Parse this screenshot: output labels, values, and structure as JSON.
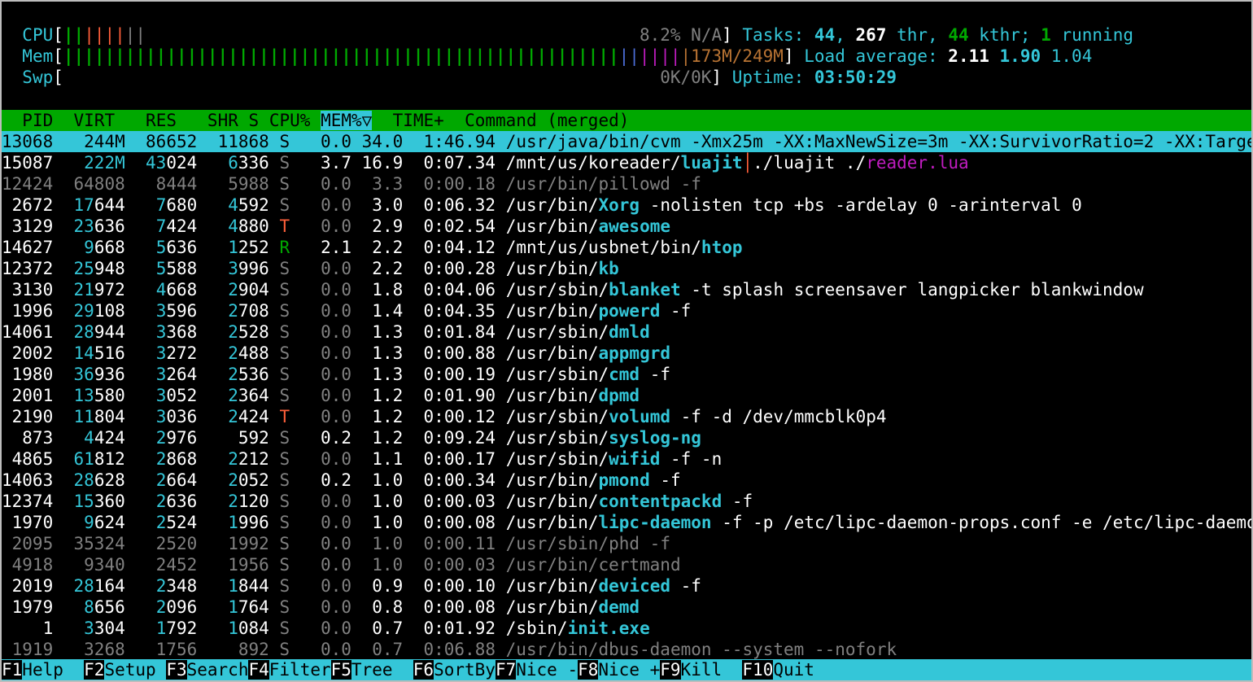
{
  "meters": {
    "cpu": {
      "label": "CPU",
      "bar_user": "||||",
      "bar_sys": "|||",
      "value": "8.2% N/A"
    },
    "mem": {
      "label": "Mem",
      "bar_used": "||||||||||||||||||||||||||||||||||||||||||||||||||||||||||||",
      "bar_buffer": "||||",
      "bar_cache": "||||",
      "value": "173M/249M"
    },
    "swp": {
      "label": "Swp",
      "bar": "",
      "value": "0K/0K"
    }
  },
  "tasks": {
    "label": "Tasks:",
    "count": "44",
    "threads": "267",
    "thr_label": "thr,",
    "kthreads": "44",
    "kthr_label": "kthr;",
    "running": "1",
    "running_label": "running"
  },
  "load": {
    "label": "Load average:",
    "one": "2.11",
    "five": "1.90",
    "fifteen": "1.04"
  },
  "uptime": {
    "label": "Uptime:",
    "value": "03:50:29"
  },
  "columns": {
    "pid": "PID",
    "virt": "VIRT",
    "res": "RES",
    "shr": "SHR",
    "s": "S",
    "cpu": "CPU%",
    "mem": "MEM%▽",
    "time": "TIME+",
    "command": "Command (merged)"
  },
  "processes": [
    {
      "pid": "13068",
      "virt": "244M",
      "res": "86652",
      "shr": "11868",
      "s": "S",
      "cpu": "0.0",
      "mem": "34.0",
      "time": "1:46.94",
      "path": "/usr/java/bin/cvm",
      "exe": "",
      "args": " -Xmx25m -XX:MaxNewSize=3m -XX:SurvivorRatio=2 -XX:Targe",
      "selected": true
    },
    {
      "pid": "15087",
      "virt": "222M",
      "res": "43024",
      "shr": "6336",
      "s": "S",
      "cpu": "3.7",
      "mem": "16.9",
      "time": "0:07.34",
      "path": "/mnt/us/koreader/",
      "exe": "luajit",
      "args": "./luajit ./",
      "extra": "reader.lua",
      "sep": "│"
    },
    {
      "pid": "12424",
      "virt": "64808",
      "res": "8444",
      "shr": "5988",
      "s": "S",
      "cpu": "0.0",
      "mem": "3.3",
      "time": "0:00.18",
      "path": "/usr/bin/pillowd",
      "exe": "",
      "args": " -f",
      "dim": true
    },
    {
      "pid": "2672",
      "virt": "17644",
      "res": "7680",
      "shr": "4592",
      "s": "S",
      "cpu": "0.0",
      "mem": "3.0",
      "time": "0:06.32",
      "path": "/usr/bin/",
      "exe": "Xorg",
      "args": " -nolisten tcp +bs -ardelay 0 -arinterval 0"
    },
    {
      "pid": "3129",
      "virt": "23636",
      "res": "7424",
      "shr": "4880",
      "s": "T",
      "cpu": "0.0",
      "mem": "2.9",
      "time": "0:02.54",
      "path": "/usr/bin/",
      "exe": "awesome",
      "args": ""
    },
    {
      "pid": "14627",
      "virt": "9668",
      "res": "5636",
      "shr": "1252",
      "s": "R",
      "cpu": "2.1",
      "mem": "2.2",
      "time": "0:04.12",
      "path": "/mnt/us/usbnet/bin/",
      "exe": "htop",
      "args": ""
    },
    {
      "pid": "12372",
      "virt": "25948",
      "res": "5588",
      "shr": "3996",
      "s": "S",
      "cpu": "0.0",
      "mem": "2.2",
      "time": "0:00.28",
      "path": "/usr/bin/",
      "exe": "kb",
      "args": ""
    },
    {
      "pid": "3130",
      "virt": "21972",
      "res": "4668",
      "shr": "2904",
      "s": "S",
      "cpu": "0.0",
      "mem": "1.8",
      "time": "0:04.06",
      "path": "/usr/sbin/",
      "exe": "blanket",
      "args": " -t splash screensaver langpicker blankwindow"
    },
    {
      "pid": "1996",
      "virt": "29108",
      "res": "3596",
      "shr": "2708",
      "s": "S",
      "cpu": "0.0",
      "mem": "1.4",
      "time": "0:04.35",
      "path": "/usr/bin/",
      "exe": "powerd",
      "args": " -f"
    },
    {
      "pid": "14061",
      "virt": "28944",
      "res": "3368",
      "shr": "2528",
      "s": "S",
      "cpu": "0.0",
      "mem": "1.3",
      "time": "0:01.84",
      "path": "/usr/sbin/",
      "exe": "dmld",
      "args": ""
    },
    {
      "pid": "2002",
      "virt": "14516",
      "res": "3272",
      "shr": "2488",
      "s": "S",
      "cpu": "0.0",
      "mem": "1.3",
      "time": "0:00.88",
      "path": "/usr/bin/",
      "exe": "appmgrd",
      "args": ""
    },
    {
      "pid": "1980",
      "virt": "36936",
      "res": "3264",
      "shr": "2536",
      "s": "S",
      "cpu": "0.0",
      "mem": "1.3",
      "time": "0:00.19",
      "path": "/usr/sbin/",
      "exe": "cmd",
      "args": " -f"
    },
    {
      "pid": "2001",
      "virt": "13580",
      "res": "3052",
      "shr": "2364",
      "s": "S",
      "cpu": "0.0",
      "mem": "1.2",
      "time": "0:01.90",
      "path": "/usr/bin/",
      "exe": "dpmd",
      "args": ""
    },
    {
      "pid": "2190",
      "virt": "11804",
      "res": "3036",
      "shr": "2424",
      "s": "T",
      "cpu": "0.0",
      "mem": "1.2",
      "time": "0:00.12",
      "path": "/usr/sbin/",
      "exe": "volumd",
      "args": " -f -d /dev/mmcblk0p4"
    },
    {
      "pid": "873",
      "virt": "4424",
      "res": "2976",
      "shr": "592",
      "s": "S",
      "cpu": "0.2",
      "mem": "1.2",
      "time": "0:09.24",
      "path": "/usr/sbin/",
      "exe": "syslog-ng",
      "args": ""
    },
    {
      "pid": "4865",
      "virt": "61812",
      "res": "2868",
      "shr": "2212",
      "s": "S",
      "cpu": "0.0",
      "mem": "1.1",
      "time": "0:00.17",
      "path": "/usr/sbin/",
      "exe": "wifid",
      "args": " -f -n"
    },
    {
      "pid": "14063",
      "virt": "28628",
      "res": "2664",
      "shr": "2052",
      "s": "S",
      "cpu": "0.2",
      "mem": "1.0",
      "time": "0:00.34",
      "path": "/usr/bin/",
      "exe": "pmond",
      "args": " -f"
    },
    {
      "pid": "12374",
      "virt": "15360",
      "res": "2636",
      "shr": "2120",
      "s": "S",
      "cpu": "0.0",
      "mem": "1.0",
      "time": "0:00.03",
      "path": "/usr/bin/",
      "exe": "contentpackd",
      "args": " -f"
    },
    {
      "pid": "1970",
      "virt": "9624",
      "res": "2524",
      "shr": "1996",
      "s": "S",
      "cpu": "0.0",
      "mem": "1.0",
      "time": "0:00.08",
      "path": "/usr/bin/",
      "exe": "lipc-daemon",
      "args": " -f -p /etc/lipc-daemon-props.conf -e /etc/lipc-daemo"
    },
    {
      "pid": "2095",
      "virt": "35324",
      "res": "2520",
      "shr": "1992",
      "s": "S",
      "cpu": "0.0",
      "mem": "1.0",
      "time": "0:00.11",
      "path": "/usr/sbin/phd",
      "exe": "",
      "args": " -f",
      "dim": true
    },
    {
      "pid": "4918",
      "virt": "9340",
      "res": "2452",
      "shr": "1956",
      "s": "S",
      "cpu": "0.0",
      "mem": "1.0",
      "time": "0:00.03",
      "path": "/usr/bin/certmand",
      "exe": "",
      "args": "",
      "dim": true
    },
    {
      "pid": "2019",
      "virt": "28164",
      "res": "2348",
      "shr": "1844",
      "s": "S",
      "cpu": "0.0",
      "mem": "0.9",
      "time": "0:00.10",
      "path": "/usr/bin/",
      "exe": "deviced",
      "args": " -f"
    },
    {
      "pid": "1979",
      "virt": "8656",
      "res": "2096",
      "shr": "1764",
      "s": "S",
      "cpu": "0.0",
      "mem": "0.8",
      "time": "0:00.08",
      "path": "/usr/bin/",
      "exe": "demd",
      "args": ""
    },
    {
      "pid": "1",
      "virt": "3304",
      "res": "1792",
      "shr": "1084",
      "s": "S",
      "cpu": "0.0",
      "mem": "0.7",
      "time": "0:01.92",
      "path": "/sbin/",
      "exe": "init.exe",
      "args": ""
    },
    {
      "pid": "1919",
      "virt": "3268",
      "res": "1756",
      "shr": "892",
      "s": "S",
      "cpu": "0.0",
      "mem": "0.7",
      "time": "0:06.88",
      "path": "/usr/bin/dbus-daemon",
      "exe": "",
      "args": " --system --nofork",
      "dim": true
    }
  ],
  "fkeys": [
    {
      "key": "F1",
      "action": "Help  "
    },
    {
      "key": "F2",
      "action": "Setup "
    },
    {
      "key": "F3",
      "action": "Search"
    },
    {
      "key": "F4",
      "action": "Filter"
    },
    {
      "key": "F5",
      "action": "Tree  "
    },
    {
      "key": "F6",
      "action": "SortBy"
    },
    {
      "key": "F7",
      "action": "Nice -"
    },
    {
      "key": "F8",
      "action": "Nice +"
    },
    {
      "key": "F9",
      "action": "Kill  "
    },
    {
      "key": "F10",
      "action": "Quit"
    }
  ]
}
